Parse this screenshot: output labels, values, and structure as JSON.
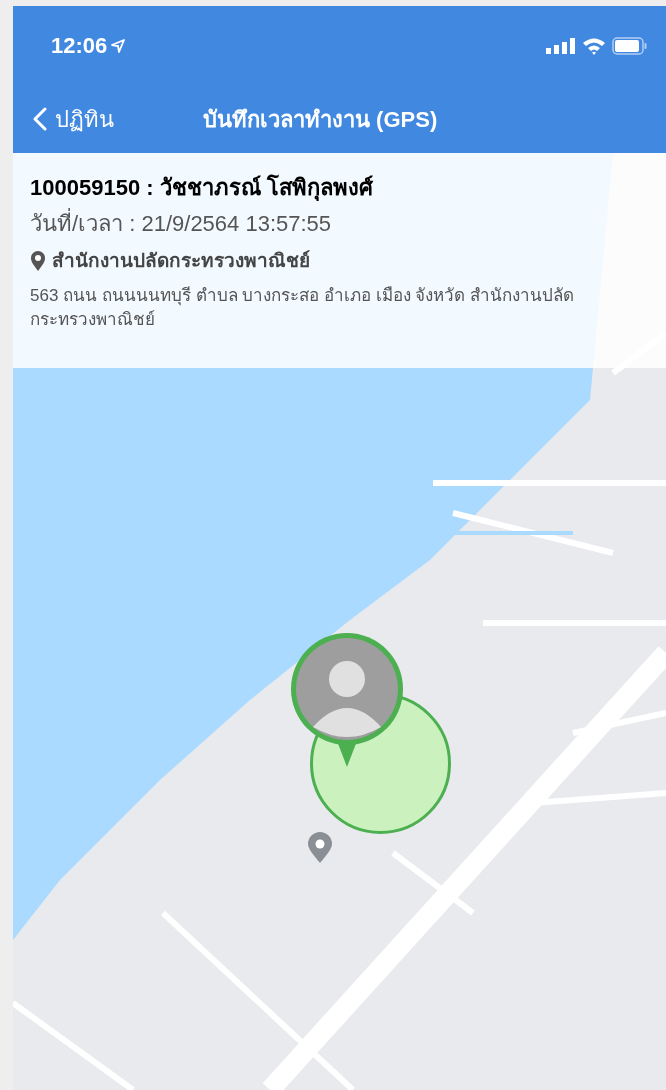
{
  "status_bar": {
    "time": "12:06"
  },
  "nav": {
    "back_label": "ปฏิทิน",
    "title": "บันทึกเวลาทำงาน (GPS)"
  },
  "info": {
    "employee": "100059150 : วัชชาภรณ์ โสพิกุลพงศ์",
    "datetime": "วันที่/เวลา : 21/9/2564 13:57:55",
    "place": "สำนักงานปลัดกระทรวงพาณิชย์",
    "address": "563 ถนน ถนนนนทบุรี ตำบล บางกระสอ อำเภอ เมือง จังหวัด สำนักงานปลัดกระทรวงพาณิชย์"
  }
}
